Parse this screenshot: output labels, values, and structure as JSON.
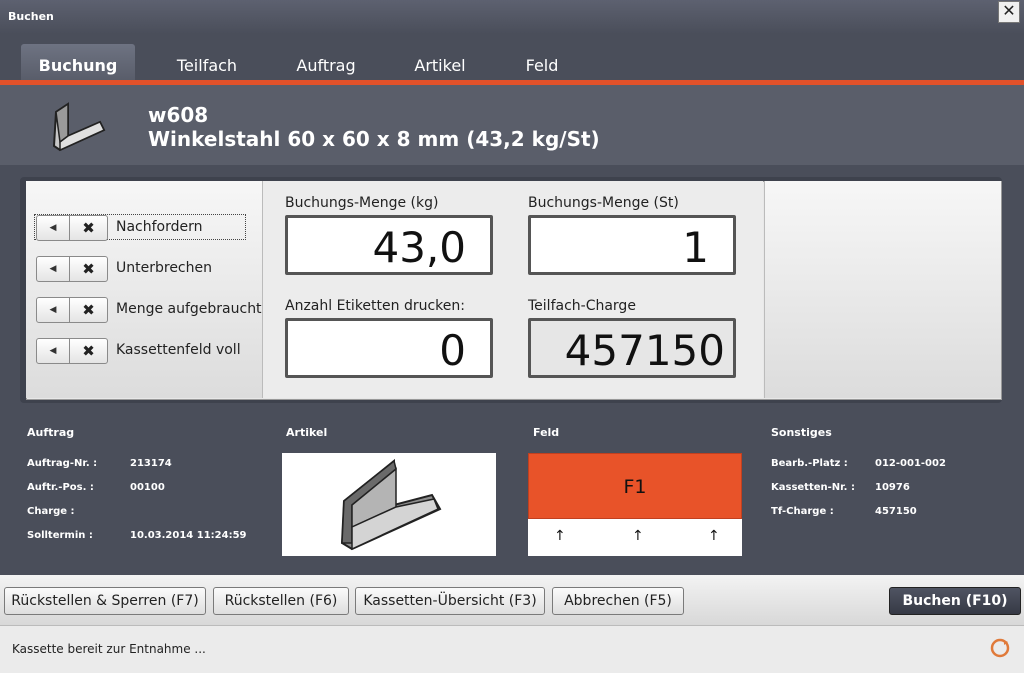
{
  "window": {
    "title": "Buchen",
    "close_glyph": "✕"
  },
  "tabs": [
    {
      "label": "Buchung",
      "active": true
    },
    {
      "label": "Teilfach",
      "active": false
    },
    {
      "label": "Auftrag",
      "active": false
    },
    {
      "label": "Artikel",
      "active": false
    },
    {
      "label": "Feld",
      "active": false
    }
  ],
  "article": {
    "code": "w608",
    "description": "Winkelstahl 60 x 60 x 8 mm  (43,2 kg/St)",
    "icon": "angle-steel-icon"
  },
  "toggles": [
    {
      "label": "Nachfordern",
      "arrow": "◀",
      "x": "✖"
    },
    {
      "label": "Unterbrechen",
      "arrow": "◀",
      "x": "✖"
    },
    {
      "label": "Menge aufgebraucht",
      "arrow": "◀",
      "x": "✖"
    },
    {
      "label": "Kassettenfeld voll",
      "arrow": "◀",
      "x": "✖"
    }
  ],
  "fields": {
    "menge_kg": {
      "label": "Buchungs-Menge (kg)",
      "value": "43,0"
    },
    "menge_st": {
      "label": "Buchungs-Menge (St)",
      "value": "1"
    },
    "etiketten": {
      "label": "Anzahl Etiketten drucken:",
      "value": "0"
    },
    "charge": {
      "label": "Teilfach-Charge",
      "value": "457150"
    }
  },
  "info": {
    "auftrag": {
      "heading": "Auftrag",
      "rows": [
        {
          "label": "Auftrag-Nr. :",
          "value": "213174"
        },
        {
          "label": "Auftr.-Pos. :",
          "value": "00100"
        },
        {
          "label": "Charge :",
          "value": ""
        },
        {
          "label": "Solltermin :",
          "value": "10.03.2014 11:24:59"
        }
      ]
    },
    "artikel": {
      "heading": "Artikel"
    },
    "feld": {
      "heading": "Feld",
      "name": "F1",
      "arrows": [
        "↑",
        "↑",
        "↑"
      ],
      "color": "#e85329"
    },
    "sonstiges": {
      "heading": "Sonstiges",
      "rows": [
        {
          "label": "Bearb.-Platz :",
          "value": "012-001-002"
        },
        {
          "label": "Kassetten-Nr. :",
          "value": "10976"
        },
        {
          "label": "Tf-Charge :",
          "value": "457150"
        }
      ]
    }
  },
  "buttons": {
    "ruecksperren": "Rückstellen & Sperren (F7)",
    "rueckstellen": "Rückstellen (F6)",
    "kassetten": "Kassetten-Übersicht (F3)",
    "abbrechen": "Abbrechen (F5)",
    "buchen": "Buchen (F10)"
  },
  "status": {
    "text": "Kassette bereit zur Entnahme ...",
    "icon": "refresh-icon"
  },
  "colors": {
    "accent": "#e2512a",
    "background": "#4a4e5a"
  }
}
